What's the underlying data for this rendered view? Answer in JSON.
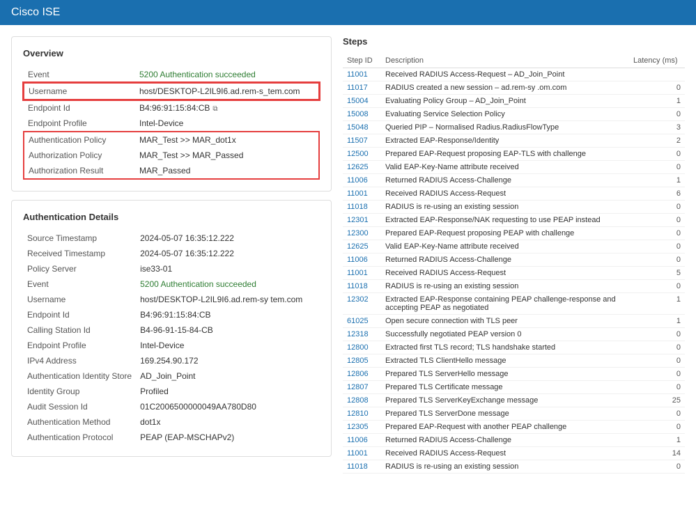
{
  "header": {
    "brand": "Cisco",
    "product": " ISE"
  },
  "overview": {
    "title": "Overview",
    "fields": [
      {
        "label": "Event",
        "value": "5200 Authentication succeeded",
        "type": "green"
      },
      {
        "label": "Username",
        "value": "host/DESKTOP-L2IL9I6.ad.rem-s_tem.com",
        "highlight": true
      },
      {
        "label": "Endpoint Id",
        "value": "B4:96:91:15:84:CB",
        "has_copy": true
      },
      {
        "label": "Endpoint Profile",
        "value": "Intel-Device"
      },
      {
        "label": "Authentication Policy",
        "value": "MAR_Test >> MAR_dot1x",
        "highlight_group": true
      },
      {
        "label": "Authorization Policy",
        "value": "MAR_Test >> MAR_Passed",
        "highlight_group": true
      },
      {
        "label": "Authorization Result",
        "value": "MAR_Passed",
        "highlight_group": true
      }
    ]
  },
  "auth_details": {
    "title": "Authentication Details",
    "fields": [
      {
        "label": "Source Timestamp",
        "value": "2024-05-07 16:35:12.222"
      },
      {
        "label": "Received Timestamp",
        "value": "2024-05-07 16:35:12.222"
      },
      {
        "label": "Policy Server",
        "value": "ise33-01"
      },
      {
        "label": "Event",
        "value": "5200 Authentication succeeded",
        "type": "green"
      },
      {
        "label": "Username",
        "value": "host/DESKTOP-L2IL9I6.ad.rem-sy tem.com"
      },
      {
        "label": "Endpoint Id",
        "value": "B4:96:91:15:84:CB"
      },
      {
        "label": "Calling Station Id",
        "value": "B4-96-91-15-84-CB"
      },
      {
        "label": "Endpoint Profile",
        "value": "Intel-Device"
      },
      {
        "label": "IPv4 Address",
        "value": "169.254.90.172"
      },
      {
        "label": "Authentication Identity Store",
        "value": "AD_Join_Point"
      },
      {
        "label": "Identity Group",
        "value": "Profiled"
      },
      {
        "label": "Audit Session Id",
        "value": "01C2006500000049AA780D80"
      },
      {
        "label": "Authentication Method",
        "value": "dot1x"
      },
      {
        "label": "Authentication Protocol",
        "value": "PEAP (EAP-MSCHAPv2)"
      }
    ]
  },
  "steps": {
    "title": "Steps",
    "columns": [
      "Step ID",
      "Description",
      "Latency (ms)"
    ],
    "rows": [
      {
        "id": "11001",
        "description": "Received RADIUS Access-Request – AD_Join_Point",
        "latency": ""
      },
      {
        "id": "11017",
        "description": "RADIUS created a new session – ad.rem-sy .om.com",
        "latency": "0"
      },
      {
        "id": "15004",
        "description": "Evaluating Policy Group – AD_Join_Point",
        "latency": "1"
      },
      {
        "id": "15008",
        "description": "Evaluating Service Selection Policy",
        "latency": "0"
      },
      {
        "id": "15048",
        "description": "Queried PIP – Normalised Radius.RadiusFlowType",
        "latency": "3"
      },
      {
        "id": "11507",
        "description": "Extracted EAP-Response/Identity",
        "latency": "2"
      },
      {
        "id": "12500",
        "description": "Prepared EAP-Request proposing EAP-TLS with challenge",
        "latency": "0"
      },
      {
        "id": "12625",
        "description": "Valid EAP-Key-Name attribute received",
        "latency": "0"
      },
      {
        "id": "11006",
        "description": "Returned RADIUS Access-Challenge",
        "latency": "1"
      },
      {
        "id": "11001",
        "description": "Received RADIUS Access-Request",
        "latency": "6"
      },
      {
        "id": "11018",
        "description": "RADIUS is re-using an existing session",
        "latency": "0"
      },
      {
        "id": "12301",
        "description": "Extracted EAP-Response/NAK requesting to use PEAP instead",
        "latency": "0"
      },
      {
        "id": "12300",
        "description": "Prepared EAP-Request proposing PEAP with challenge",
        "latency": "0"
      },
      {
        "id": "12625",
        "description": "Valid EAP-Key-Name attribute received",
        "latency": "0"
      },
      {
        "id": "11006",
        "description": "Returned RADIUS Access-Challenge",
        "latency": "0"
      },
      {
        "id": "11001",
        "description": "Received RADIUS Access-Request",
        "latency": "5"
      },
      {
        "id": "11018",
        "description": "RADIUS is re-using an existing session",
        "latency": "0"
      },
      {
        "id": "12302",
        "description": "Extracted EAP-Response containing PEAP challenge-response and accepting PEAP as negotiated",
        "latency": "1"
      },
      {
        "id": "61025",
        "description": "Open secure connection with TLS peer",
        "latency": "1"
      },
      {
        "id": "12318",
        "description": "Successfully negotiated PEAP version 0",
        "latency": "0"
      },
      {
        "id": "12800",
        "description": "Extracted first TLS record; TLS handshake started",
        "latency": "0"
      },
      {
        "id": "12805",
        "description": "Extracted TLS ClientHello message",
        "latency": "0"
      },
      {
        "id": "12806",
        "description": "Prepared TLS ServerHello message",
        "latency": "0"
      },
      {
        "id": "12807",
        "description": "Prepared TLS Certificate message",
        "latency": "0"
      },
      {
        "id": "12808",
        "description": "Prepared TLS ServerKeyExchange message",
        "latency": "25"
      },
      {
        "id": "12810",
        "description": "Prepared TLS ServerDone message",
        "latency": "0"
      },
      {
        "id": "12305",
        "description": "Prepared EAP-Request with another PEAP challenge",
        "latency": "0"
      },
      {
        "id": "11006",
        "description": "Returned RADIUS Access-Challenge",
        "latency": "1"
      },
      {
        "id": "11001",
        "description": "Received RADIUS Access-Request",
        "latency": "14"
      },
      {
        "id": "11018",
        "description": "RADIUS is re-using an existing session",
        "latency": "0"
      }
    ]
  }
}
